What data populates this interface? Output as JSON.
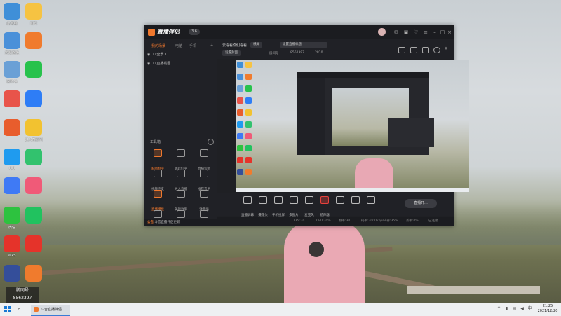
{
  "desktop": {
    "icons": [
      {
        "name": "此电脑",
        "color": "#3f8fd8"
      },
      {
        "name": "萌宠",
        "color": "#f6c342"
      },
      {
        "name": "控制面板",
        "color": "#4a90d9"
      },
      {
        "name": "",
        "color": "#f07b2d"
      },
      {
        "name": "回收站",
        "color": "#6aa0d6"
      },
      {
        "name": "",
        "color": "#27c24c"
      },
      {
        "name": "",
        "color": "#e8544a"
      },
      {
        "name": "",
        "color": "#2e7df6"
      },
      {
        "name": "",
        "color": "#e85d2d"
      },
      {
        "name": "进入直播间",
        "color": "#f2c230"
      },
      {
        "name": "QQ",
        "color": "#1f9bef"
      },
      {
        "name": "",
        "color": "#32c26e"
      },
      {
        "name": "",
        "color": "#3f7af5"
      },
      {
        "name": "",
        "color": "#f05a78"
      },
      {
        "name": "微信",
        "color": "#2dc23f"
      },
      {
        "name": "",
        "color": "#21c25f"
      },
      {
        "name": "WPS",
        "color": "#e5332a"
      },
      {
        "name": "",
        "color": "#e5332a"
      },
      {
        "name": "",
        "color": "#344e9a"
      },
      {
        "name": "",
        "color": "#f07b2d"
      }
    ],
    "stream_badge": {
      "line1": "鹏同号",
      "line2": "8562397"
    }
  },
  "window": {
    "app_name": "直播伴侣",
    "version": "3.6",
    "left_tabs": [
      "我的场景",
      "电脑",
      "手机",
      "",
      "写合并"
    ],
    "scenes": [
      "全景 1",
      "直播截图"
    ],
    "tools_title": "工具箱",
    "tools": [
      {
        "label": "贴图框字",
        "hot": true
      },
      {
        "label": "跳跃红字",
        "hot": false
      },
      {
        "label": "直播诊断",
        "hot": false
      },
      {
        "label": "视频连麦",
        "hot": false
      },
      {
        "label": "导入直播",
        "hot": false
      },
      {
        "label": "推荐音乐",
        "hot": false
      },
      {
        "label": "直播模板",
        "hot": true
      },
      {
        "label": "美颜效果",
        "hot": false
      },
      {
        "label": "弹幕墙",
        "hot": false
      },
      {
        "label": "",
        "hot": false
      },
      {
        "label": "",
        "hot": false
      },
      {
        "label": "",
        "hot": false
      }
    ],
    "notice": {
      "tag": "公告",
      "text": "斗音直播伴侣更新"
    },
    "room": {
      "title": "去看看你们看看",
      "tag": "横屏",
      "label2": "设置封面",
      "title_field": "设置直播标题",
      "room_id_label": "房间号",
      "room_id": "8562397",
      "viewers": "2810"
    },
    "controls": [
      {
        "label": "直播屏幕",
        "red": false
      },
      {
        "label": "摄像头",
        "red": false
      },
      {
        "label": "手机投屏",
        "red": false
      },
      {
        "label": "多图片",
        "red": false
      },
      {
        "label": "麦克风",
        "red": false
      },
      {
        "label": "扬声器",
        "red": true
      },
      {
        "label": "",
        "red": false
      },
      {
        "label": "",
        "red": false
      },
      {
        "label": "",
        "red": false
      }
    ],
    "start_button": "直播开...",
    "status": [
      "FPS:30",
      "CPU:30%",
      "帧率:30",
      "码率:2000kbps",
      "内存:35%",
      "丢帧:0%",
      "已连接"
    ]
  },
  "taskbar": {
    "app_label": "斗音直播伴侣",
    "time": "21:25",
    "date": "2021/12/20"
  }
}
